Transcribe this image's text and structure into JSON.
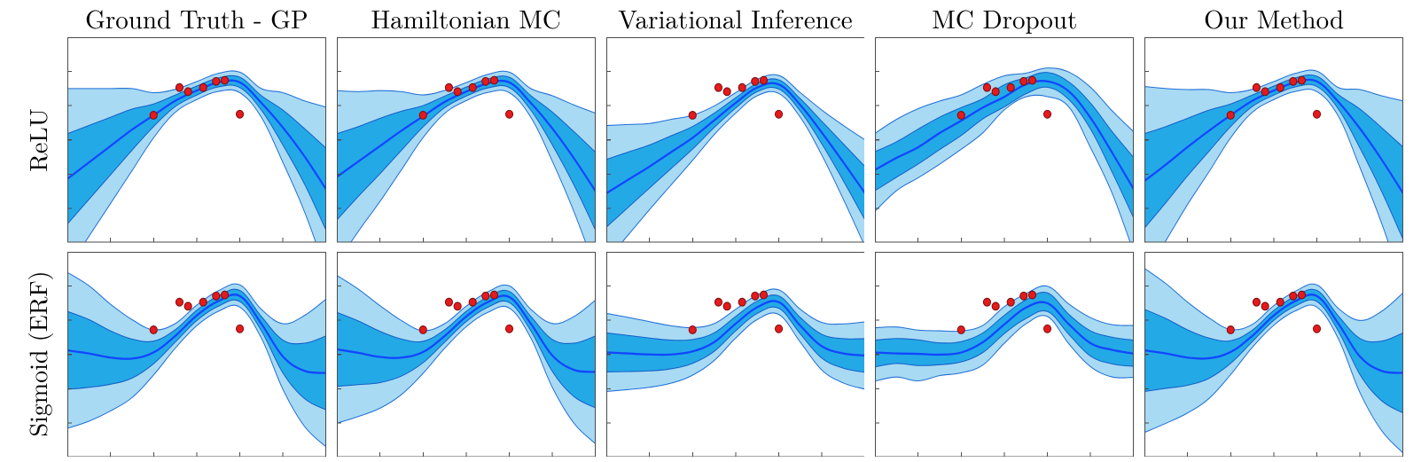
{
  "titles": {
    "cols": [
      "Ground Truth - GP",
      "Hamiltonian MC",
      "Variational Inference",
      "MC Dropout",
      "Our Method"
    ],
    "rows": [
      "ReLU",
      "Sigmoid (ERF)"
    ]
  },
  "colors": {
    "mean": "#1147ff",
    "band_inner": "#1ca7e6",
    "band_outer": "#9ed6f2",
    "dot_fill": "#e41a1c",
    "dot_stroke": "#7a0d0e",
    "frame": "#4b4b4b"
  },
  "chart_data": {
    "type": "line",
    "layout": {
      "rows": 2,
      "cols": 5,
      "ticks_per_axis": 6
    },
    "xlim": [
      -6,
      6
    ],
    "ylim": [
      -5,
      5
    ],
    "x": [
      -6,
      -5,
      -4,
      -3,
      -2,
      -1,
      0,
      1,
      2,
      3,
      4,
      5,
      6
    ],
    "observations": {
      "x": [
        -2.0,
        -0.8,
        -0.4,
        0.3,
        0.9,
        1.3,
        2.0
      ],
      "y": [
        1.2,
        2.55,
        2.35,
        2.55,
        2.85,
        2.9,
        1.25
      ]
    },
    "panels": [
      {
        "row": 0,
        "col": 0,
        "activation": "ReLU",
        "method": "Ground Truth - GP",
        "mean": [
          -1.9,
          -1.1,
          -0.3,
          0.5,
          1.2,
          1.9,
          2.4,
          2.8,
          2.8,
          1.8,
          0.6,
          -0.8,
          -2.4
        ],
        "sd": [
          2.2,
          1.8,
          1.4,
          1.0,
          0.55,
          0.28,
          0.22,
          0.22,
          0.25,
          0.35,
          0.85,
          1.35,
          2.0
        ]
      },
      {
        "row": 0,
        "col": 1,
        "activation": "ReLU",
        "method": "Hamiltonian MC",
        "mean": [
          -1.8,
          -1.05,
          -0.3,
          0.45,
          1.15,
          1.85,
          2.35,
          2.75,
          2.8,
          1.8,
          0.55,
          -0.9,
          -2.5
        ],
        "sd": [
          2.1,
          1.7,
          1.35,
          0.95,
          0.52,
          0.28,
          0.22,
          0.22,
          0.25,
          0.35,
          0.8,
          1.3,
          1.9
        ]
      },
      {
        "row": 0,
        "col": 2,
        "activation": "ReLU",
        "method": "Variational Inference",
        "mean": [
          -2.6,
          -1.95,
          -1.3,
          -0.6,
          0.1,
          0.95,
          1.8,
          2.55,
          2.7,
          1.7,
          0.35,
          -1.1,
          -2.6
        ],
        "sd": [
          1.65,
          1.35,
          1.05,
          0.8,
          0.55,
          0.35,
          0.25,
          0.2,
          0.22,
          0.3,
          0.55,
          0.9,
          1.3
        ]
      },
      {
        "row": 0,
        "col": 3,
        "activation": "ReLU",
        "method": "MC Dropout",
        "noise": 0.18,
        "mean": [
          -1.4,
          -0.85,
          -0.3,
          0.3,
          0.9,
          1.55,
          2.15,
          2.65,
          2.9,
          2.35,
          1.1,
          -0.6,
          -2.4
        ],
        "sd": [
          0.95,
          0.88,
          0.82,
          0.72,
          0.62,
          0.52,
          0.42,
          0.35,
          0.32,
          0.42,
          0.68,
          1.05,
          1.45
        ]
      },
      {
        "row": 0,
        "col": 4,
        "activation": "ReLU",
        "method": "Our Method",
        "mean": [
          -2.0,
          -1.2,
          -0.35,
          0.45,
          1.2,
          1.9,
          2.4,
          2.8,
          2.85,
          1.85,
          0.55,
          -0.95,
          -2.6
        ],
        "sd": [
          2.3,
          1.85,
          1.4,
          1.0,
          0.55,
          0.28,
          0.22,
          0.22,
          0.25,
          0.35,
          0.95,
          1.55,
          2.25
        ]
      },
      {
        "row": 1,
        "col": 0,
        "activation": "Sigmoid (ERF)",
        "method": "Ground Truth - GP",
        "mean": [
          0.2,
          0.05,
          -0.15,
          -0.2,
          0.1,
          0.9,
          1.9,
          2.6,
          2.85,
          1.5,
          -0.1,
          -0.8,
          -0.9
        ],
        "sd": [
          1.9,
          1.65,
          1.3,
          0.95,
          0.55,
          0.3,
          0.25,
          0.25,
          0.27,
          0.35,
          0.8,
          1.35,
          1.8
        ]
      },
      {
        "row": 1,
        "col": 1,
        "activation": "Sigmoid (ERF)",
        "method": "Hamiltonian MC",
        "mean": [
          0.25,
          0.08,
          -0.12,
          -0.15,
          0.12,
          0.9,
          1.85,
          2.55,
          2.8,
          1.5,
          -0.05,
          -0.75,
          -0.85
        ],
        "sd": [
          1.8,
          1.55,
          1.25,
          0.9,
          0.52,
          0.3,
          0.25,
          0.25,
          0.27,
          0.35,
          0.78,
          1.3,
          1.75
        ]
      },
      {
        "row": 1,
        "col": 2,
        "activation": "Sigmoid (ERF)",
        "method": "Variational Inference",
        "mean": [
          0.1,
          0.05,
          0.0,
          0.0,
          0.15,
          0.6,
          1.5,
          2.3,
          2.55,
          1.4,
          0.4,
          0.05,
          -0.05
        ],
        "sd": [
          0.95,
          0.88,
          0.8,
          0.7,
          0.58,
          0.45,
          0.35,
          0.3,
          0.3,
          0.4,
          0.58,
          0.72,
          0.82
        ]
      },
      {
        "row": 1,
        "col": 3,
        "activation": "Sigmoid (ERF)",
        "method": "MC Dropout",
        "noise": 0.15,
        "mean": [
          0.15,
          0.1,
          0.05,
          0.02,
          0.1,
          0.55,
          1.45,
          2.25,
          2.55,
          1.5,
          0.55,
          0.2,
          0.08
        ],
        "sd": [
          0.65,
          0.62,
          0.6,
          0.58,
          0.55,
          0.5,
          0.45,
          0.42,
          0.42,
          0.48,
          0.55,
          0.6,
          0.62
        ]
      },
      {
        "row": 1,
        "col": 4,
        "activation": "Sigmoid (ERF)",
        "method": "Our Method",
        "mean": [
          0.2,
          0.05,
          -0.15,
          -0.18,
          0.12,
          0.9,
          1.9,
          2.6,
          2.85,
          1.5,
          -0.1,
          -0.8,
          -0.9
        ],
        "sd": [
          2.0,
          1.7,
          1.35,
          0.98,
          0.55,
          0.28,
          0.24,
          0.24,
          0.27,
          0.37,
          0.88,
          1.45,
          1.95
        ]
      }
    ]
  }
}
